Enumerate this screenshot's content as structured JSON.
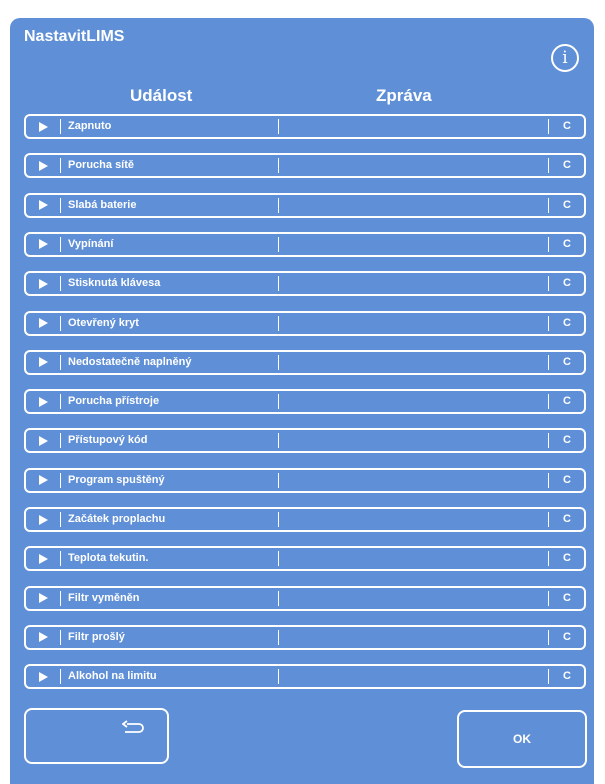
{
  "dialog": {
    "title": "NastavitLIMS",
    "info_icon": "info-icon",
    "info_glyph": "i"
  },
  "table": {
    "headers": {
      "event": "Událost",
      "message": "Zpráva"
    },
    "rows": [
      {
        "event": "Zapnuto",
        "message": "",
        "clear_label": "C"
      },
      {
        "event": "Porucha sítě",
        "message": "",
        "clear_label": "C"
      },
      {
        "event": "Slabá baterie",
        "message": "",
        "clear_label": "C"
      },
      {
        "event": "Vypínání",
        "message": "",
        "clear_label": "C"
      },
      {
        "event": "Stisknutá klávesa",
        "message": "",
        "clear_label": "C"
      },
      {
        "event": "Otevřený kryt",
        "message": "",
        "clear_label": "C"
      },
      {
        "event": "Nedostatečně naplněný",
        "message": "",
        "clear_label": "C"
      },
      {
        "event": "Porucha přístroje",
        "message": "",
        "clear_label": "C"
      },
      {
        "event": "Přístupový kód",
        "message": "",
        "clear_label": "C"
      },
      {
        "event": "Program spuštěný",
        "message": "",
        "clear_label": "C"
      },
      {
        "event": "Začátek proplachu",
        "message": "",
        "clear_label": "C"
      },
      {
        "event": "Teplota tekutin.",
        "message": "",
        "clear_label": "C"
      },
      {
        "event": "Filtr vyměněn",
        "message": "",
        "clear_label": "C"
      },
      {
        "event": "Filtr prošlý",
        "message": "",
        "clear_label": "C"
      },
      {
        "event": "Alkohol na limitu",
        "message": "",
        "clear_label": "C"
      }
    ]
  },
  "footer": {
    "back_icon": "back-arrow-icon",
    "ok_label": "OK"
  },
  "colors": {
    "panel": "#5f8fd6",
    "text": "#ffffff"
  }
}
